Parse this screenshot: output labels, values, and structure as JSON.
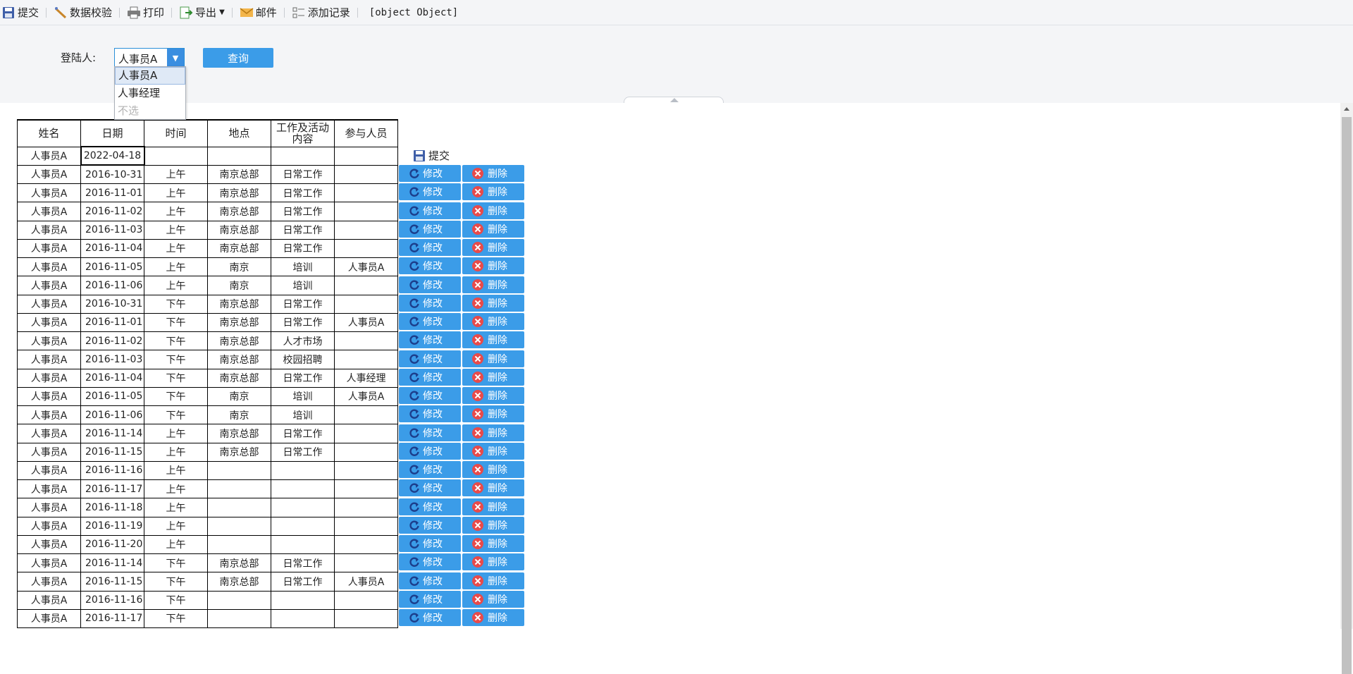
{
  "toolbar": {
    "submit": "提交",
    "validate": "数据校验",
    "print": "打印",
    "export": "导出",
    "mail": "邮件",
    "add_record": "添加记录",
    "object_text": "[object Object]"
  },
  "param": {
    "label": "登陆人:",
    "selected": "人事员A",
    "query": "查询",
    "options": [
      "人事员A",
      "人事经理",
      "不选"
    ]
  },
  "table": {
    "headers": [
      "姓名",
      "日期",
      "时间",
      "地点",
      "工作及活动内容",
      "参与人员"
    ],
    "edit_row": [
      "人事员A",
      "2022-04-18",
      "",
      "",
      "",
      ""
    ],
    "rows": [
      [
        "人事员A",
        "2016-10-31",
        "上午",
        "南京总部",
        "日常工作",
        ""
      ],
      [
        "人事员A",
        "2016-11-01",
        "上午",
        "南京总部",
        "日常工作",
        ""
      ],
      [
        "人事员A",
        "2016-11-02",
        "上午",
        "南京总部",
        "日常工作",
        ""
      ],
      [
        "人事员A",
        "2016-11-03",
        "上午",
        "南京总部",
        "日常工作",
        ""
      ],
      [
        "人事员A",
        "2016-11-04",
        "上午",
        "南京总部",
        "日常工作",
        ""
      ],
      [
        "人事员A",
        "2016-11-05",
        "上午",
        "南京",
        "培训",
        "人事员A"
      ],
      [
        "人事员A",
        "2016-11-06",
        "上午",
        "南京",
        "培训",
        ""
      ],
      [
        "人事员A",
        "2016-10-31",
        "下午",
        "南京总部",
        "日常工作",
        ""
      ],
      [
        "人事员A",
        "2016-11-01",
        "下午",
        "南京总部",
        "日常工作",
        "人事员A"
      ],
      [
        "人事员A",
        "2016-11-02",
        "下午",
        "南京总部",
        "人才市场",
        ""
      ],
      [
        "人事员A",
        "2016-11-03",
        "下午",
        "南京总部",
        "校园招聘",
        ""
      ],
      [
        "人事员A",
        "2016-11-04",
        "下午",
        "南京总部",
        "日常工作",
        "人事经理"
      ],
      [
        "人事员A",
        "2016-11-05",
        "下午",
        "南京",
        "培训",
        "人事员A"
      ],
      [
        "人事员A",
        "2016-11-06",
        "下午",
        "南京",
        "培训",
        ""
      ],
      [
        "人事员A",
        "2016-11-14",
        "上午",
        "南京总部",
        "日常工作",
        ""
      ],
      [
        "人事员A",
        "2016-11-15",
        "上午",
        "南京总部",
        "日常工作",
        ""
      ],
      [
        "人事员A",
        "2016-11-16",
        "上午",
        "",
        "",
        ""
      ],
      [
        "人事员A",
        "2016-11-17",
        "上午",
        "",
        "",
        ""
      ],
      [
        "人事员A",
        "2016-11-18",
        "上午",
        "",
        "",
        ""
      ],
      [
        "人事员A",
        "2016-11-19",
        "上午",
        "",
        "",
        ""
      ],
      [
        "人事员A",
        "2016-11-20",
        "上午",
        "",
        "",
        ""
      ],
      [
        "人事员A",
        "2016-11-14",
        "下午",
        "南京总部",
        "日常工作",
        ""
      ],
      [
        "人事员A",
        "2016-11-15",
        "下午",
        "南京总部",
        "日常工作",
        "人事员A"
      ],
      [
        "人事员A",
        "2016-11-16",
        "下午",
        "",
        "",
        ""
      ],
      [
        "人事员A",
        "2016-11-17",
        "下午",
        "",
        "",
        ""
      ]
    ]
  },
  "actions": {
    "submit": "提交",
    "edit": "修改",
    "delete": "删除"
  },
  "colors": {
    "accent": "#3b9ce8",
    "delete_icon": "#e84a4a",
    "toolbar_bg": "#f4f5f7"
  }
}
